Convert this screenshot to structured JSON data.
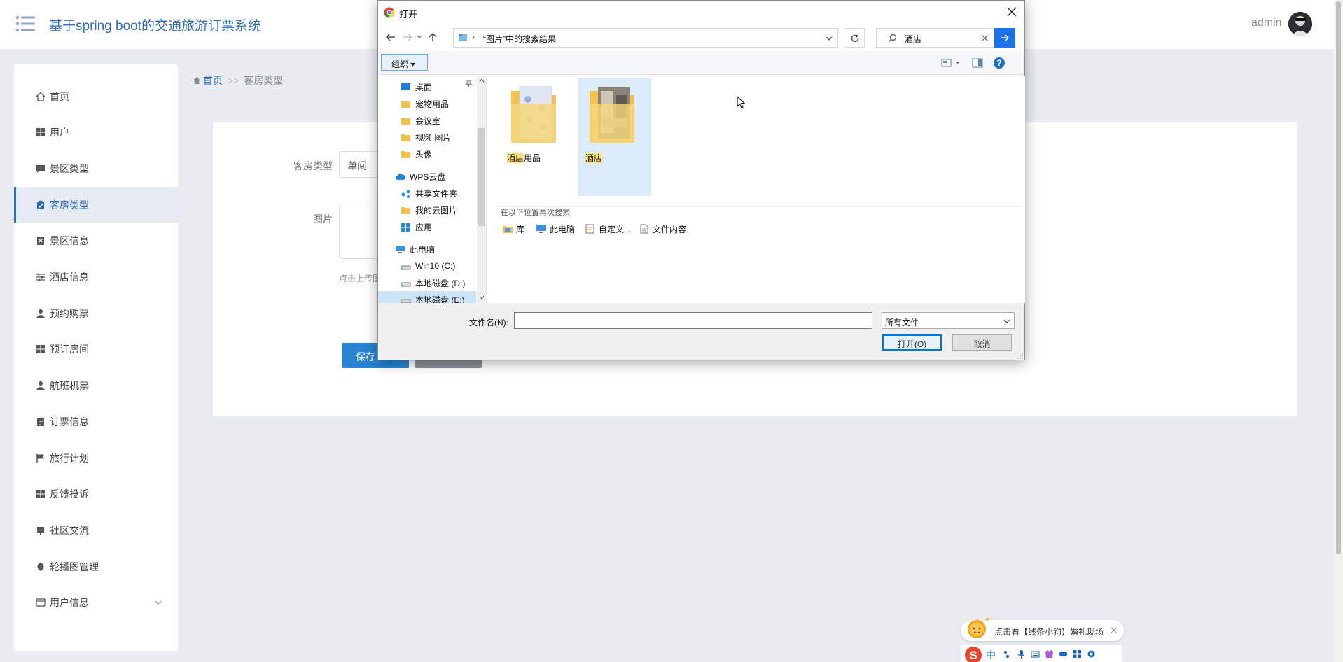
{
  "header": {
    "title": "基于spring boot的交通旅游订票系统",
    "user": "admin"
  },
  "sidebar": {
    "items": [
      {
        "label": "首页",
        "icon": "home-icon"
      },
      {
        "label": "用户",
        "icon": "grid-icon"
      },
      {
        "label": "景区类型",
        "icon": "comment-icon"
      },
      {
        "label": "客房类型",
        "icon": "checklist-icon",
        "active": true
      },
      {
        "label": "景区信息",
        "icon": "close-box-icon"
      },
      {
        "label": "酒店信息",
        "icon": "sliders-icon"
      },
      {
        "label": "预约购票",
        "icon": "user-icon"
      },
      {
        "label": "预订房间",
        "icon": "grid-icon"
      },
      {
        "label": "航班机票",
        "icon": "user-icon"
      },
      {
        "label": "订票信息",
        "icon": "clipboard-icon"
      },
      {
        "label": "旅行计划",
        "icon": "flag-icon"
      },
      {
        "label": "反馈投诉",
        "icon": "grid-icon"
      },
      {
        "label": "社区交流",
        "icon": "signpost-icon"
      },
      {
        "label": "轮播图管理",
        "icon": "leaf-icon"
      },
      {
        "label": "用户信息",
        "icon": "card-icon"
      }
    ]
  },
  "breadcrumb": {
    "home": "首页",
    "separator": ">>",
    "current": "客房类型"
  },
  "form": {
    "type_label": "客房类型",
    "type_value": "单间",
    "image_label": "图片",
    "upload_tip": "点击上传图",
    "save_label": "保存"
  },
  "dialog": {
    "title": "打开",
    "address": "“图片”中的搜索结果",
    "search_query": "酒店",
    "organize": "组织",
    "tree": [
      {
        "label": "桌面",
        "type": "desktop"
      },
      {
        "label": "宠物用品",
        "type": "folder"
      },
      {
        "label": "会议室",
        "type": "folder"
      },
      {
        "label": "视频 图片",
        "type": "folder"
      },
      {
        "label": "头像",
        "type": "folder"
      },
      {
        "label": "WPS云盘",
        "type": "cloud"
      },
      {
        "label": "共享文件夹",
        "type": "share"
      },
      {
        "label": "我的云图片",
        "type": "folder"
      },
      {
        "label": "应用",
        "type": "apps"
      },
      {
        "label": "此电脑",
        "type": "pc"
      },
      {
        "label": "Win10 (C:)",
        "type": "drive"
      },
      {
        "label": "本地磁盘 (D:)",
        "type": "drive"
      },
      {
        "label": "本地磁盘 (E:)",
        "type": "drive",
        "selected": true
      }
    ],
    "files": [
      {
        "highlight": "酒店",
        "rest": "用品"
      },
      {
        "highlight": "酒店",
        "rest": ""
      }
    ],
    "search_again_label": "在以下位置再次搜索:",
    "locations": [
      "库",
      "此电脑",
      "自定义...",
      "文件内容"
    ],
    "filename_label": "文件名(N):",
    "filename_value": "",
    "filetype": "所有文件",
    "open_label": "打开(O)",
    "cancel_label": "取消"
  },
  "notification": {
    "text": "点击看【线条小狗】婚礼现场"
  },
  "ime": {
    "mode": "中"
  }
}
